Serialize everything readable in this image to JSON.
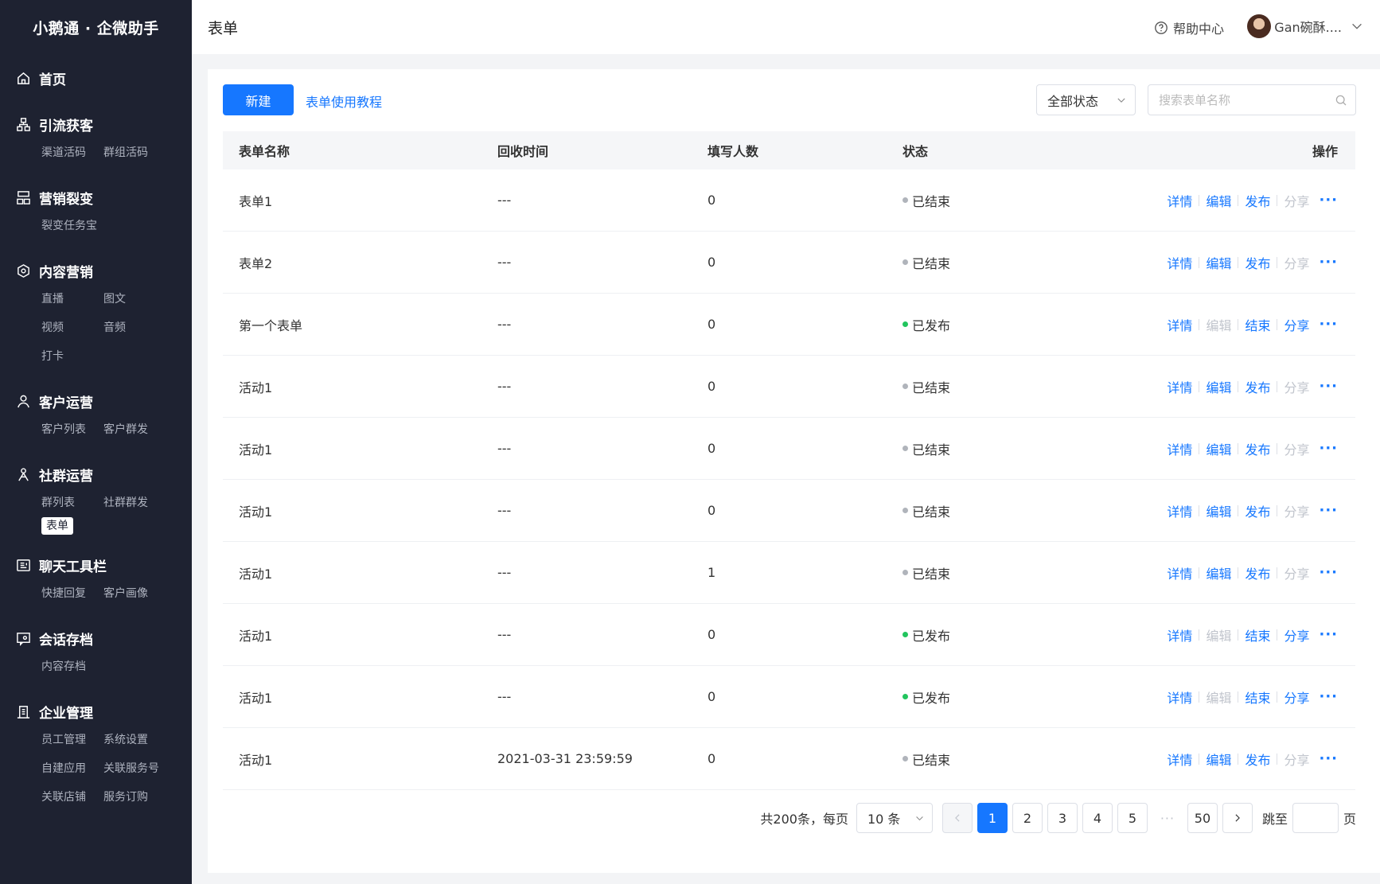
{
  "brand": "小鹅通 · 企微助手",
  "sidebar": {
    "groups": [
      {
        "label": "首页",
        "icon": "home-icon",
        "items": []
      },
      {
        "label": "引流获客",
        "icon": "network-icon",
        "items": [
          "渠道活码",
          "群组活码"
        ]
      },
      {
        "label": "营销裂变",
        "icon": "org-chart-icon",
        "items": [
          "裂变任务宝"
        ]
      },
      {
        "label": "内容营销",
        "icon": "cube-icon",
        "items": [
          "直播",
          "图文",
          "视频",
          "音频",
          "打卡"
        ]
      },
      {
        "label": "客户运营",
        "icon": "user-icon",
        "items": [
          "客户列表",
          "客户群发"
        ]
      },
      {
        "label": "社群运营",
        "icon": "group-icon",
        "items": [
          "群列表",
          "社群群发",
          "表单"
        ]
      },
      {
        "label": "聊天工具栏",
        "icon": "toolbar-icon",
        "items": [
          "快捷回复",
          "客户画像"
        ]
      },
      {
        "label": "会话存档",
        "icon": "chat-archive-icon",
        "items": [
          "内容存档"
        ]
      },
      {
        "label": "企业管理",
        "icon": "building-icon",
        "items": [
          "员工管理",
          "系统设置",
          "自建应用",
          "关联服务号",
          "关联店铺",
          "服务订购"
        ]
      }
    ],
    "active_item": "表单"
  },
  "header": {
    "title": "表单",
    "help": "帮助中心",
    "user": "Gan碗酥...."
  },
  "toolbar": {
    "new_label": "新建",
    "tutorial_label": "表单使用教程",
    "status_filter": "全部状态",
    "search_placeholder": "搜索表单名称"
  },
  "table": {
    "headers": {
      "name": "表单名称",
      "time": "回收时间",
      "count": "填写人数",
      "status": "状态",
      "ops": "操作"
    },
    "rows": [
      {
        "name": "表单1",
        "time": "---",
        "count": "0",
        "status": "已结束",
        "published": false
      },
      {
        "name": "表单2",
        "time": "---",
        "count": "0",
        "status": "已结束",
        "published": false
      },
      {
        "name": "第一个表单",
        "time": "---",
        "count": "0",
        "status": "已发布",
        "published": true
      },
      {
        "name": "活动1",
        "time": "---",
        "count": "0",
        "status": "已结束",
        "published": false
      },
      {
        "name": "活动1",
        "time": "---",
        "count": "0",
        "status": "已结束",
        "published": false
      },
      {
        "name": "活动1",
        "time": "---",
        "count": "0",
        "status": "已结束",
        "published": false
      },
      {
        "name": "活动1",
        "time": "---",
        "count": "1",
        "status": "已结束",
        "published": false
      },
      {
        "name": "活动1",
        "time": "---",
        "count": "0",
        "status": "已发布",
        "published": true
      },
      {
        "name": "活动1",
        "time": "---",
        "count": "0",
        "status": "已发布",
        "published": true
      },
      {
        "name": "活动1",
        "time": "2021-03-31 23:59:59",
        "count": "0",
        "status": "已结束",
        "published": false
      }
    ],
    "actions": {
      "detail": "详情",
      "edit": "编辑",
      "publish": "发布",
      "end": "结束",
      "share": "分享",
      "more": "···"
    }
  },
  "colors": {
    "accent": "#1677ff",
    "published": "#22c55e",
    "ended": "#b0b4bb",
    "sidebar_bg": "#1e2231"
  },
  "pagination": {
    "total": "共200条，每页",
    "page_size": "10 条",
    "pages": [
      "1",
      "2",
      "3",
      "4",
      "5"
    ],
    "ellipsis": "···",
    "last": "50",
    "current": "1",
    "jump_label": "跳至",
    "page_suffix": "页"
  }
}
